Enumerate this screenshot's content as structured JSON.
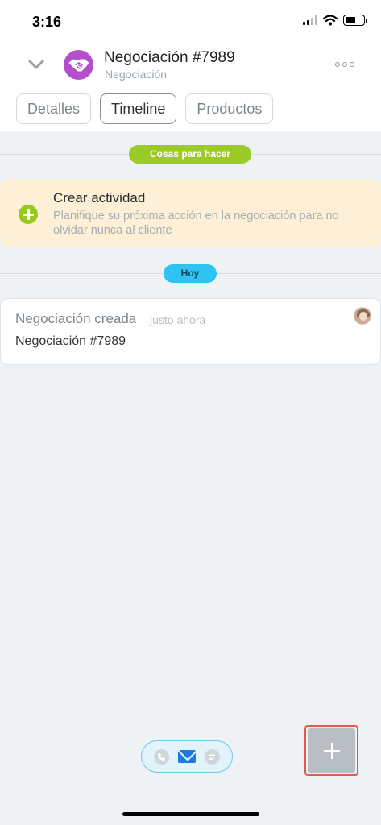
{
  "status_bar": {
    "time": "3:16"
  },
  "header": {
    "title": "Negociación #7989",
    "subtitle": "Negociación",
    "avatar_color": "#b34fce",
    "collapse_icon": "chevron-down-icon",
    "more_icon": "more-dots-icon"
  },
  "tabs": [
    {
      "label": "Detalles"
    },
    {
      "label": "Timeline",
      "active": true
    },
    {
      "label": "Productos"
    }
  ],
  "timeline": {
    "todo_label": "Cosas para hacer",
    "create_activity": {
      "title": "Crear actividad",
      "description": "Planifique su próxima acción en la negociación para no olvidar nunca al cliente"
    },
    "today_label": "Hoy",
    "event": {
      "title": "Negociación creada",
      "time": "justo ahora",
      "body": "Negociación #7989"
    }
  },
  "quick_actions": [
    {
      "icon": "phone-icon",
      "active": false
    },
    {
      "icon": "mail-icon",
      "active": true
    },
    {
      "icon": "chat-icon",
      "active": false
    }
  ],
  "fab": {
    "icon": "plus-icon"
  },
  "colors": {
    "todo_pill": "#9ccb27",
    "today_pill": "#2ec3f2",
    "activity_bg": "#fdf0d6",
    "accent_blue": "#1d7ae0"
  }
}
